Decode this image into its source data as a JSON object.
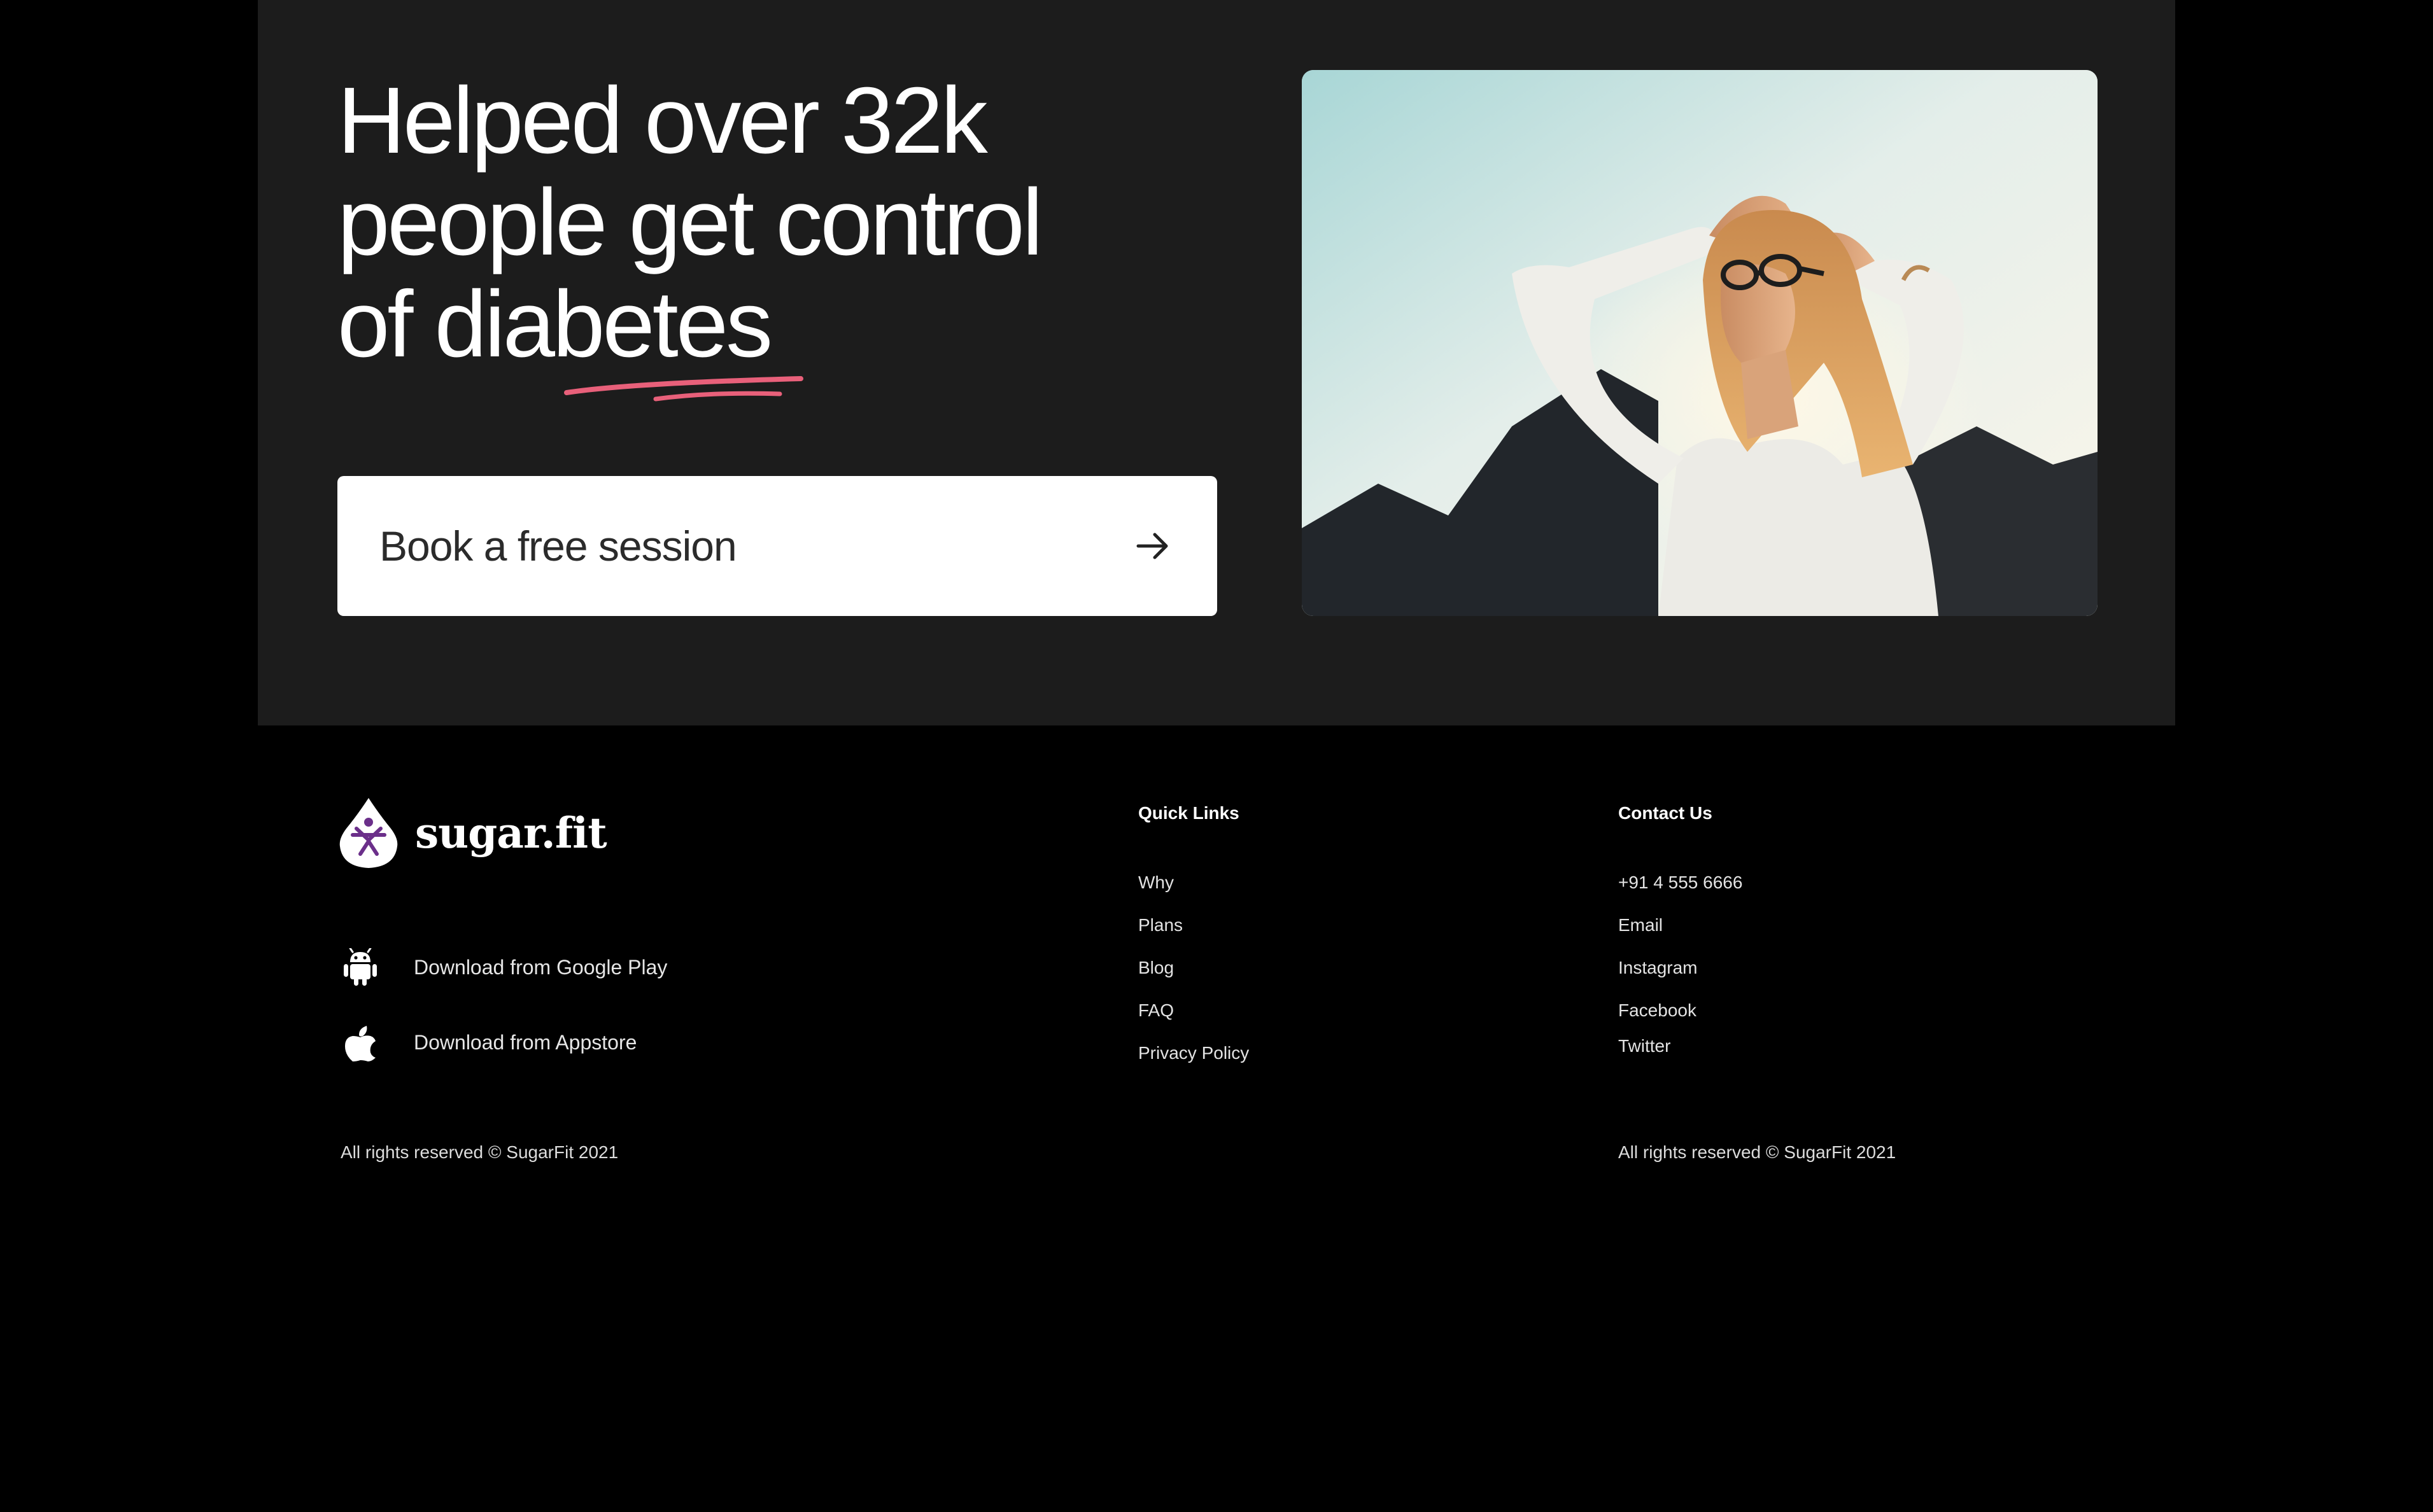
{
  "hero": {
    "title_line1": "Helped over 32k",
    "title_line2": "people get control",
    "title_line3": "of diabetes",
    "accent_color": "#e8607a",
    "cta_label": "Book a free session",
    "cta_icon": "arrow-right-icon",
    "photo_alt": "woman-enjoying-sunlight"
  },
  "footer": {
    "brand": {
      "name": "sugar.fit",
      "logo_icon": "sugarfit-drop-logo-icon",
      "logo_color": "#6b2f8a"
    },
    "stores": [
      {
        "label": "Download from Google Play",
        "icon": "android-icon"
      },
      {
        "label": "Download from Appstore",
        "icon": "apple-icon"
      }
    ],
    "quick_links": {
      "heading": "Quick Links",
      "items": [
        "Why",
        "Plans",
        "Blog",
        "FAQ",
        "Privacy Policy"
      ]
    },
    "contact": {
      "heading": "Contact Us",
      "items": [
        "+91 4 555 6666",
        "Email",
        "Instagram",
        "Facebook",
        "Twitter"
      ]
    },
    "copyright_left": "All rights reserved © SugarFit 2021",
    "copyright_right": "All rights reserved © SugarFit 2021"
  },
  "colors": {
    "page_background": "#000000",
    "hero_background": "#1c1c1c",
    "button_background": "#ffffff",
    "text_primary": "#ffffff"
  }
}
